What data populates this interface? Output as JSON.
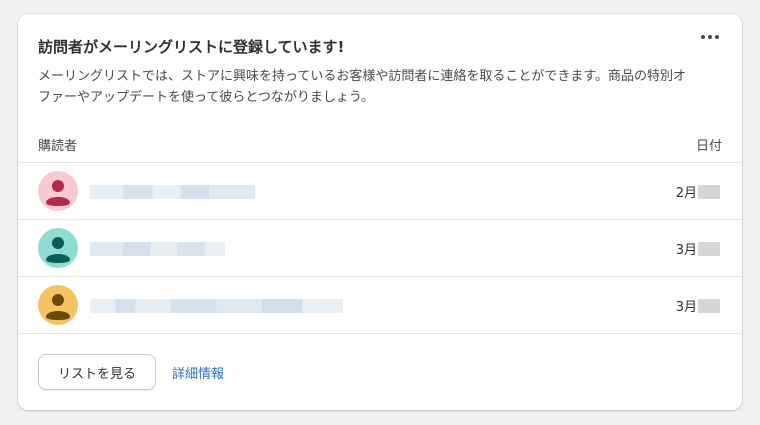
{
  "card": {
    "title": "訪問者がメーリングリストに登録しています!",
    "description": "メーリングリストでは、ストアに興味を持っているお客様や訪問者に連絡を取ることができます。商品の特別オファーやアップデートを使って彼らとつながりましょう。",
    "menu_icon": "more-horizontal-icon"
  },
  "table": {
    "headers": {
      "subscriber": "購読者",
      "date": "日付"
    },
    "rows": [
      {
        "avatar_bg": "#f8c9d2",
        "avatar_fg": "#b3284c",
        "name": "",
        "date_month": "2月"
      },
      {
        "avatar_bg": "#8fdcd2",
        "avatar_fg": "#0b5e57",
        "name": "",
        "date_month": "3月"
      },
      {
        "avatar_bg": "#f7c35f",
        "avatar_fg": "#6b4a0e",
        "name": "",
        "date_month": "3月"
      }
    ]
  },
  "footer": {
    "view_list_label": "リストを見る",
    "details_link": "詳細情報"
  },
  "colors": {
    "link": "#2c6ecb",
    "name_blur": "#dbe6ef"
  }
}
